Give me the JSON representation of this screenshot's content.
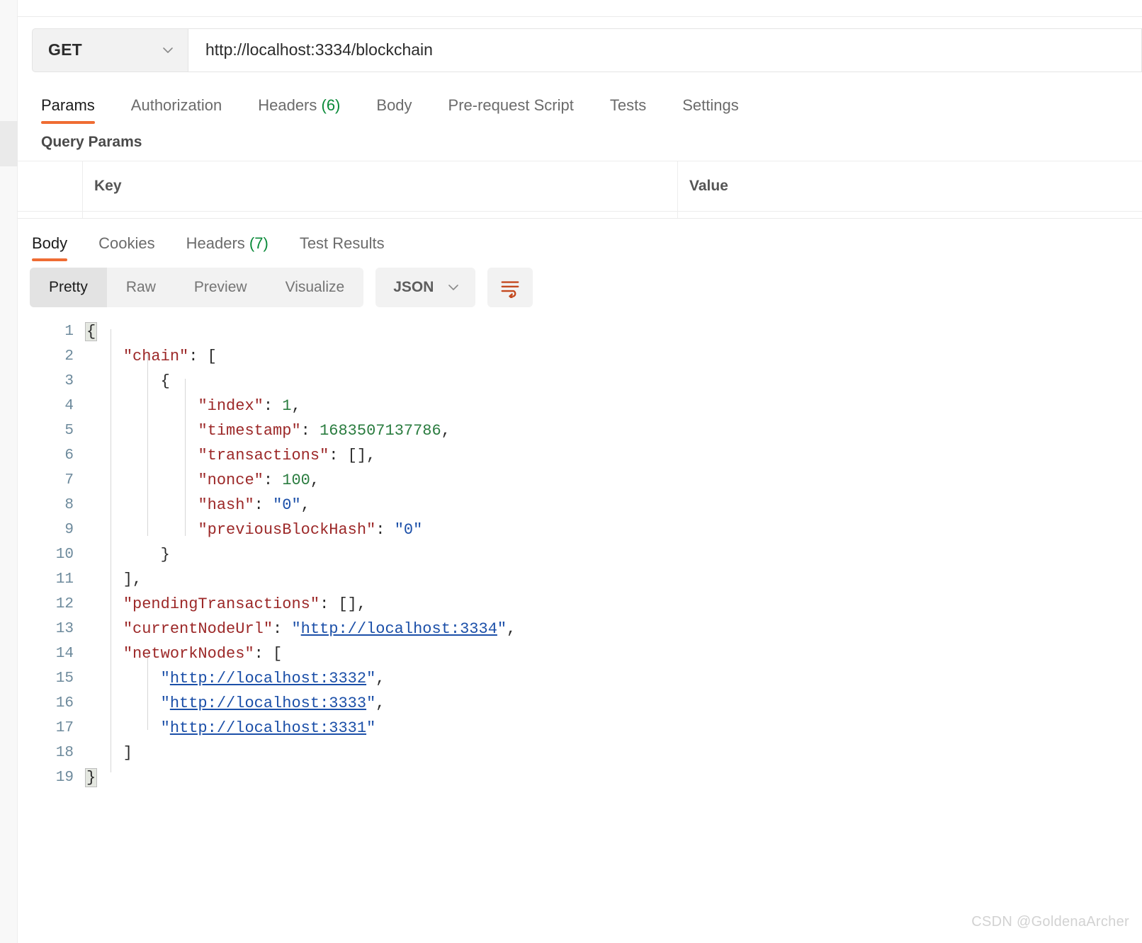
{
  "request": {
    "method": "GET",
    "method_caret": "chevron-down",
    "url": "http://localhost:3334/blockchain",
    "tabs": [
      {
        "label": "Params",
        "count": "",
        "active": true
      },
      {
        "label": "Authorization",
        "count": "",
        "active": false
      },
      {
        "label": "Headers",
        "count": "(6)",
        "active": false
      },
      {
        "label": "Body",
        "count": "",
        "active": false
      },
      {
        "label": "Pre-request Script",
        "count": "",
        "active": false
      },
      {
        "label": "Tests",
        "count": "",
        "active": false
      },
      {
        "label": "Settings",
        "count": "",
        "active": false
      }
    ],
    "query_params_title": "Query Params",
    "table": {
      "columns": [
        "Key",
        "Value"
      ]
    }
  },
  "response": {
    "tabs": [
      {
        "label": "Body",
        "count": "",
        "active": true
      },
      {
        "label": "Cookies",
        "count": "",
        "active": false
      },
      {
        "label": "Headers",
        "count": "(7)",
        "active": false
      },
      {
        "label": "Test Results",
        "count": "",
        "active": false
      }
    ],
    "view_modes": [
      {
        "label": "Pretty",
        "active": true
      },
      {
        "label": "Raw",
        "active": false
      },
      {
        "label": "Preview",
        "active": false
      },
      {
        "label": "Visualize",
        "active": false
      }
    ],
    "format": "JSON",
    "format_caret": "chevron-down",
    "wrap_icon": "word-wrap-icon"
  },
  "body": {
    "line_numbers": [
      "1",
      "2",
      "3",
      "4",
      "5",
      "6",
      "7",
      "8",
      "9",
      "10",
      "11",
      "12",
      "13",
      "14",
      "15",
      "16",
      "17",
      "18",
      "19"
    ],
    "lines": [
      {
        "n": "1",
        "segments": [
          {
            "t": "{",
            "c": "punct brace"
          }
        ]
      },
      {
        "n": "2",
        "segments": [
          {
            "t": "    ",
            "c": "punct"
          },
          {
            "t": "\"chain\"",
            "c": "key"
          },
          {
            "t": ": [",
            "c": "punct"
          }
        ]
      },
      {
        "n": "3",
        "segments": [
          {
            "t": "        {",
            "c": "punct"
          }
        ]
      },
      {
        "n": "4",
        "segments": [
          {
            "t": "            ",
            "c": "punct"
          },
          {
            "t": "\"index\"",
            "c": "key"
          },
          {
            "t": ": ",
            "c": "punct"
          },
          {
            "t": "1",
            "c": "num"
          },
          {
            "t": ",",
            "c": "punct"
          }
        ]
      },
      {
        "n": "5",
        "segments": [
          {
            "t": "            ",
            "c": "punct"
          },
          {
            "t": "\"timestamp\"",
            "c": "key"
          },
          {
            "t": ": ",
            "c": "punct"
          },
          {
            "t": "1683507137786",
            "c": "num"
          },
          {
            "t": ",",
            "c": "punct"
          }
        ]
      },
      {
        "n": "6",
        "segments": [
          {
            "t": "            ",
            "c": "punct"
          },
          {
            "t": "\"transactions\"",
            "c": "key"
          },
          {
            "t": ": [],",
            "c": "punct"
          }
        ]
      },
      {
        "n": "7",
        "segments": [
          {
            "t": "            ",
            "c": "punct"
          },
          {
            "t": "\"nonce\"",
            "c": "key"
          },
          {
            "t": ": ",
            "c": "punct"
          },
          {
            "t": "100",
            "c": "num"
          },
          {
            "t": ",",
            "c": "punct"
          }
        ]
      },
      {
        "n": "8",
        "segments": [
          {
            "t": "            ",
            "c": "punct"
          },
          {
            "t": "\"hash\"",
            "c": "key"
          },
          {
            "t": ": ",
            "c": "punct"
          },
          {
            "t": "\"0\"",
            "c": "str"
          },
          {
            "t": ",",
            "c": "punct"
          }
        ]
      },
      {
        "n": "9",
        "segments": [
          {
            "t": "            ",
            "c": "punct"
          },
          {
            "t": "\"previousBlockHash\"",
            "c": "key"
          },
          {
            "t": ": ",
            "c": "punct"
          },
          {
            "t": "\"0\"",
            "c": "str"
          }
        ]
      },
      {
        "n": "10",
        "segments": [
          {
            "t": "        }",
            "c": "punct"
          }
        ]
      },
      {
        "n": "11",
        "segments": [
          {
            "t": "    ],",
            "c": "punct"
          }
        ]
      },
      {
        "n": "12",
        "segments": [
          {
            "t": "    ",
            "c": "punct"
          },
          {
            "t": "\"pendingTransactions\"",
            "c": "key"
          },
          {
            "t": ": [],",
            "c": "punct"
          }
        ]
      },
      {
        "n": "13",
        "segments": [
          {
            "t": "    ",
            "c": "punct"
          },
          {
            "t": "\"currentNodeUrl\"",
            "c": "key"
          },
          {
            "t": ": ",
            "c": "punct"
          },
          {
            "t": "\"",
            "c": "str"
          },
          {
            "t": "http://localhost:3334",
            "c": "link"
          },
          {
            "t": "\"",
            "c": "str"
          },
          {
            "t": ",",
            "c": "punct"
          }
        ]
      },
      {
        "n": "14",
        "segments": [
          {
            "t": "    ",
            "c": "punct"
          },
          {
            "t": "\"networkNodes\"",
            "c": "key"
          },
          {
            "t": ": [",
            "c": "punct"
          }
        ]
      },
      {
        "n": "15",
        "segments": [
          {
            "t": "        ",
            "c": "punct"
          },
          {
            "t": "\"",
            "c": "str"
          },
          {
            "t": "http://localhost:3332",
            "c": "link"
          },
          {
            "t": "\"",
            "c": "str"
          },
          {
            "t": ",",
            "c": "punct"
          }
        ]
      },
      {
        "n": "16",
        "segments": [
          {
            "t": "        ",
            "c": "punct"
          },
          {
            "t": "\"",
            "c": "str"
          },
          {
            "t": "http://localhost:3333",
            "c": "link"
          },
          {
            "t": "\"",
            "c": "str"
          },
          {
            "t": ",",
            "c": "punct"
          }
        ]
      },
      {
        "n": "17",
        "segments": [
          {
            "t": "        ",
            "c": "punct"
          },
          {
            "t": "\"",
            "c": "str"
          },
          {
            "t": "http://localhost:3331",
            "c": "link"
          },
          {
            "t": "\"",
            "c": "str"
          }
        ]
      },
      {
        "n": "18",
        "segments": [
          {
            "t": "    ]",
            "c": "punct"
          }
        ]
      },
      {
        "n": "19",
        "segments": [
          {
            "t": "}",
            "c": "punct brace"
          }
        ]
      }
    ],
    "parsed": {
      "chain": [
        {
          "index": 1,
          "timestamp": 1683507137786,
          "transactions": [],
          "nonce": 100,
          "hash": "0",
          "previousBlockHash": "0"
        }
      ],
      "pendingTransactions": [],
      "currentNodeUrl": "http://localhost:3334",
      "networkNodes": [
        "http://localhost:3332",
        "http://localhost:3333",
        "http://localhost:3331"
      ]
    }
  },
  "watermark": "CSDN @GoldenaArcher",
  "colors": {
    "accent": "#ef6c33",
    "key": "#9c2828",
    "number": "#2a7c3f",
    "string": "#1b4fa8",
    "count": "#0a8a39",
    "line_number": "#6d8a9c"
  }
}
